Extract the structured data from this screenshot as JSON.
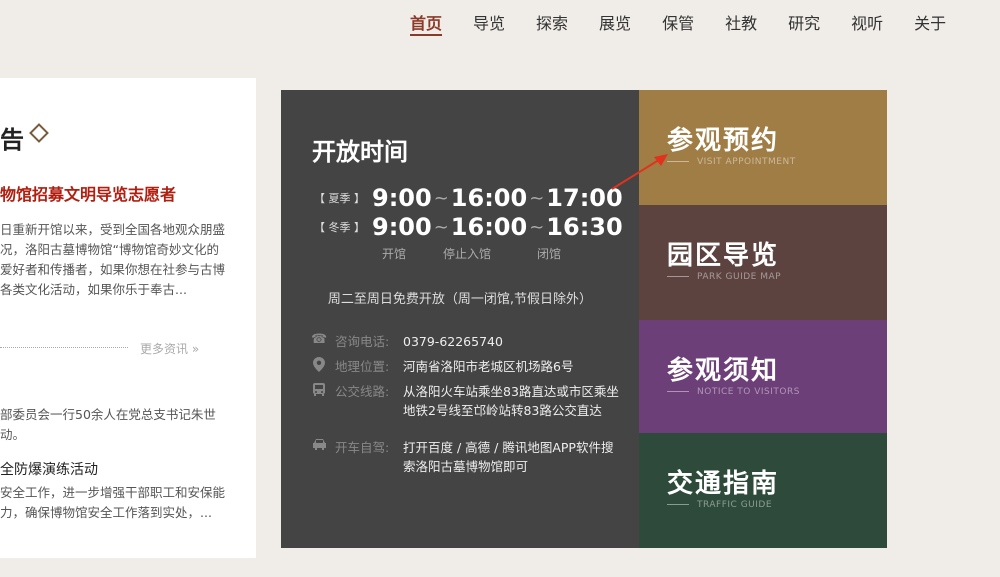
{
  "nav": {
    "items": [
      "首页",
      "导览",
      "探索",
      "展览",
      "保管",
      "社教",
      "研究",
      "视听",
      "关于"
    ],
    "active_index": 0
  },
  "news": {
    "heading": "告",
    "featured_title": "物馆招募文明导览志愿者",
    "featured_body": "日重新开馆以来，受到全国各地观众朋盛况，洛阳古墓博物馆“博物馆奇妙文化的爱好者和传播者，如果你想在社参与古博各类文化活动，如果你乐于奉古...",
    "more_label": "更多资讯 »",
    "item1": "部委员会一行50余人在党总支书记朱世动。",
    "item2_title": "全防爆演练活动",
    "item2_body": "安全工作，进一步增强干部职工和安保能力，确保博物馆安全工作落到实处，..."
  },
  "info": {
    "title": "开放时间",
    "summer_label": "【 夏季 】",
    "summer_open": "9:00",
    "summer_stop": "16:00",
    "summer_close": "17:00",
    "winter_label": "【 冬季 】",
    "winter_open": "9:00",
    "winter_stop": "16:00",
    "winter_close": "16:30",
    "tilde": "~",
    "label_open": "开馆",
    "label_stop": "停止入馆",
    "label_close": "闭馆",
    "free_notice": "周二至周日免费开放（周一闭馆,节假日除外）",
    "phone_label": "咨询电话:",
    "phone": "0379-62265740",
    "address_label": "地理位置:",
    "address": "河南省洛阳市老城区机场路6号",
    "bus_label": "公交线路:",
    "bus": "从洛阳火车站乘坐83路直达或市区乘坐地铁2号线至邙岭站转83路公交直达",
    "drive_label": "开车自驾:",
    "drive": "打开百度 / 高德 / 腾讯地图APP软件搜索洛阳古墓博物馆即可"
  },
  "tiles": [
    {
      "title": "参观预约",
      "sub": "VISIT APPOINTMENT",
      "color": "#a07d45"
    },
    {
      "title": "园区导览",
      "sub": "PARK GUIDE MAP",
      "color": "#5c4340"
    },
    {
      "title": "参观须知",
      "sub": "NOTICE TO VISITORS",
      "color": "#6d3f78"
    },
    {
      "title": "交通指南",
      "sub": "TRAFFIC GUIDE",
      "color": "#2d4a3a"
    }
  ],
  "colors": {
    "accent": "#8b3a2a",
    "featured_red": "#b01e10",
    "panel_dark": "#444444",
    "arrow_red": "#e0321c"
  },
  "icons": [
    "phone-icon",
    "location-icon",
    "bus-icon",
    "car-icon",
    "diamond-ornament-icon",
    "pointer-arrow"
  ]
}
